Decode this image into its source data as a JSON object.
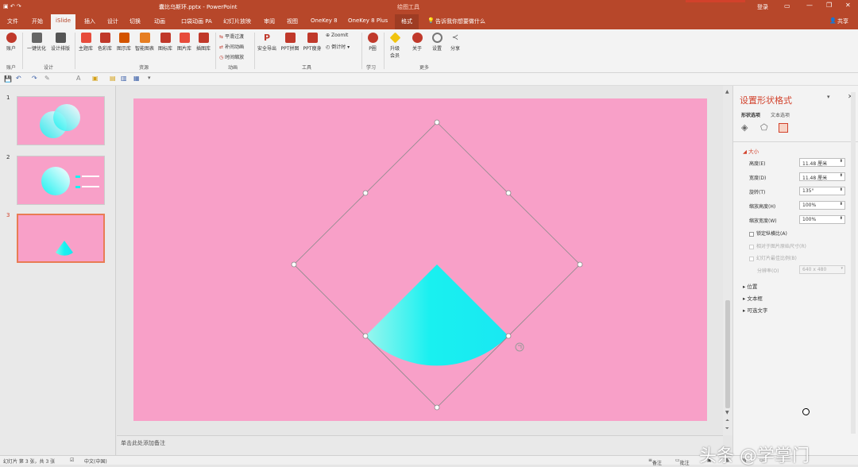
{
  "window": {
    "title": "囊比乌斯环.pptx - PowerPoint",
    "context_tab": "绘图工具",
    "sign_in": "登录",
    "share": "共享"
  },
  "tabs": [
    "文件",
    "开始",
    "iSlide",
    "插入",
    "设计",
    "切换",
    "动画",
    "口袋动画 PA",
    "幻灯片放映",
    "审阅",
    "视图",
    "OneKey 8",
    "OneKey 8 Plus",
    "格式"
  ],
  "tell_me": "告诉我你想要做什么",
  "ribbon": {
    "buttons": {
      "account": "账户",
      "one_click": "一键优化",
      "design_layout": "设计排版",
      "theme_lib": "主题库",
      "color_lib": "色彩库",
      "diagram_lib": "图示库",
      "smart_chart": "智能图表",
      "icon_lib": "图标库",
      "image_lib": "图片库",
      "illus_lib": "插图库",
      "smooth_transition": "平滑过渡",
      "tween": "补间动画",
      "time_scale": "时间缩放",
      "safe_export": "安全导出",
      "ppt_collage": "PPT拼图",
      "ppt_slim": "PPT瘦身",
      "zoomit": "ZoomIt",
      "countdown": "倒计时",
      "p_lecture": "P圈",
      "upgrade": "升级会员",
      "about": "关于",
      "settings": "设置",
      "share": "分享"
    },
    "groups": {
      "account": "账户",
      "design": "设计",
      "resources": "资源",
      "animation": "动画",
      "tools": "工具",
      "learn": "学习",
      "more": "更多"
    }
  },
  "slides": [
    {
      "num": "1"
    },
    {
      "num": "2"
    },
    {
      "num": "3"
    }
  ],
  "notes_placeholder": "单击此处添加备注",
  "format_pane": {
    "title": "设置形状格式",
    "tab_shape": "形状选项",
    "tab_text": "文本选项",
    "section_size": "大小",
    "height_label": "高度(E)",
    "height_value": "11.48 厘米",
    "width_label": "宽度(D)",
    "width_value": "11.48 厘米",
    "rotation_label": "旋转(T)",
    "rotation_value": "135°",
    "scale_h_label": "缩放高度(H)",
    "scale_h_value": "100%",
    "scale_w_label": "缩放宽度(W)",
    "scale_w_value": "100%",
    "lock_aspect": "锁定纵横比(A)",
    "relative_orig": "相对于图片原始尺寸(R)",
    "best_scale": "幻灯片最佳比例(B)",
    "resolution_label": "分辨率(O)",
    "resolution_value": "640 x 480",
    "section_position": "位置",
    "section_textbox": "文本框",
    "section_alt": "可选文字"
  },
  "status": {
    "slide_of": "幻灯片 第 3 张，共 3 张",
    "language": "中文(中国)",
    "notes": "备注",
    "comments": "批注"
  },
  "watermark": "头条 @学掌门",
  "colors": {
    "accent": "#b7472a",
    "slide_bg": "#f8a0c8",
    "cyan": "#19f0f0",
    "white": "#ffffff"
  }
}
